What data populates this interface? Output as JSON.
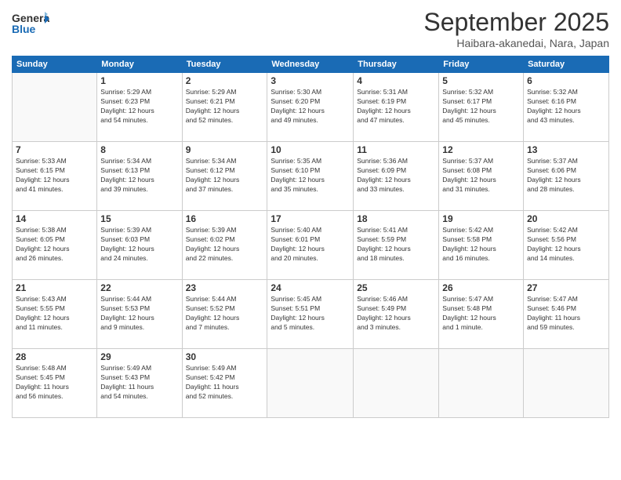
{
  "header": {
    "logo_general": "General",
    "logo_blue": "Blue",
    "month": "September 2025",
    "location": "Haibara-akanedai, Nara, Japan"
  },
  "days_of_week": [
    "Sunday",
    "Monday",
    "Tuesday",
    "Wednesday",
    "Thursday",
    "Friday",
    "Saturday"
  ],
  "weeks": [
    [
      {
        "day": "",
        "info": ""
      },
      {
        "day": "1",
        "info": "Sunrise: 5:29 AM\nSunset: 6:23 PM\nDaylight: 12 hours\nand 54 minutes."
      },
      {
        "day": "2",
        "info": "Sunrise: 5:29 AM\nSunset: 6:21 PM\nDaylight: 12 hours\nand 52 minutes."
      },
      {
        "day": "3",
        "info": "Sunrise: 5:30 AM\nSunset: 6:20 PM\nDaylight: 12 hours\nand 49 minutes."
      },
      {
        "day": "4",
        "info": "Sunrise: 5:31 AM\nSunset: 6:19 PM\nDaylight: 12 hours\nand 47 minutes."
      },
      {
        "day": "5",
        "info": "Sunrise: 5:32 AM\nSunset: 6:17 PM\nDaylight: 12 hours\nand 45 minutes."
      },
      {
        "day": "6",
        "info": "Sunrise: 5:32 AM\nSunset: 6:16 PM\nDaylight: 12 hours\nand 43 minutes."
      }
    ],
    [
      {
        "day": "7",
        "info": "Sunrise: 5:33 AM\nSunset: 6:15 PM\nDaylight: 12 hours\nand 41 minutes."
      },
      {
        "day": "8",
        "info": "Sunrise: 5:34 AM\nSunset: 6:13 PM\nDaylight: 12 hours\nand 39 minutes."
      },
      {
        "day": "9",
        "info": "Sunrise: 5:34 AM\nSunset: 6:12 PM\nDaylight: 12 hours\nand 37 minutes."
      },
      {
        "day": "10",
        "info": "Sunrise: 5:35 AM\nSunset: 6:10 PM\nDaylight: 12 hours\nand 35 minutes."
      },
      {
        "day": "11",
        "info": "Sunrise: 5:36 AM\nSunset: 6:09 PM\nDaylight: 12 hours\nand 33 minutes."
      },
      {
        "day": "12",
        "info": "Sunrise: 5:37 AM\nSunset: 6:08 PM\nDaylight: 12 hours\nand 31 minutes."
      },
      {
        "day": "13",
        "info": "Sunrise: 5:37 AM\nSunset: 6:06 PM\nDaylight: 12 hours\nand 28 minutes."
      }
    ],
    [
      {
        "day": "14",
        "info": "Sunrise: 5:38 AM\nSunset: 6:05 PM\nDaylight: 12 hours\nand 26 minutes."
      },
      {
        "day": "15",
        "info": "Sunrise: 5:39 AM\nSunset: 6:03 PM\nDaylight: 12 hours\nand 24 minutes."
      },
      {
        "day": "16",
        "info": "Sunrise: 5:39 AM\nSunset: 6:02 PM\nDaylight: 12 hours\nand 22 minutes."
      },
      {
        "day": "17",
        "info": "Sunrise: 5:40 AM\nSunset: 6:01 PM\nDaylight: 12 hours\nand 20 minutes."
      },
      {
        "day": "18",
        "info": "Sunrise: 5:41 AM\nSunset: 5:59 PM\nDaylight: 12 hours\nand 18 minutes."
      },
      {
        "day": "19",
        "info": "Sunrise: 5:42 AM\nSunset: 5:58 PM\nDaylight: 12 hours\nand 16 minutes."
      },
      {
        "day": "20",
        "info": "Sunrise: 5:42 AM\nSunset: 5:56 PM\nDaylight: 12 hours\nand 14 minutes."
      }
    ],
    [
      {
        "day": "21",
        "info": "Sunrise: 5:43 AM\nSunset: 5:55 PM\nDaylight: 12 hours\nand 11 minutes."
      },
      {
        "day": "22",
        "info": "Sunrise: 5:44 AM\nSunset: 5:53 PM\nDaylight: 12 hours\nand 9 minutes."
      },
      {
        "day": "23",
        "info": "Sunrise: 5:44 AM\nSunset: 5:52 PM\nDaylight: 12 hours\nand 7 minutes."
      },
      {
        "day": "24",
        "info": "Sunrise: 5:45 AM\nSunset: 5:51 PM\nDaylight: 12 hours\nand 5 minutes."
      },
      {
        "day": "25",
        "info": "Sunrise: 5:46 AM\nSunset: 5:49 PM\nDaylight: 12 hours\nand 3 minutes."
      },
      {
        "day": "26",
        "info": "Sunrise: 5:47 AM\nSunset: 5:48 PM\nDaylight: 12 hours\nand 1 minute."
      },
      {
        "day": "27",
        "info": "Sunrise: 5:47 AM\nSunset: 5:46 PM\nDaylight: 11 hours\nand 59 minutes."
      }
    ],
    [
      {
        "day": "28",
        "info": "Sunrise: 5:48 AM\nSunset: 5:45 PM\nDaylight: 11 hours\nand 56 minutes."
      },
      {
        "day": "29",
        "info": "Sunrise: 5:49 AM\nSunset: 5:43 PM\nDaylight: 11 hours\nand 54 minutes."
      },
      {
        "day": "30",
        "info": "Sunrise: 5:49 AM\nSunset: 5:42 PM\nDaylight: 11 hours\nand 52 minutes."
      },
      {
        "day": "",
        "info": ""
      },
      {
        "day": "",
        "info": ""
      },
      {
        "day": "",
        "info": ""
      },
      {
        "day": "",
        "info": ""
      }
    ]
  ]
}
